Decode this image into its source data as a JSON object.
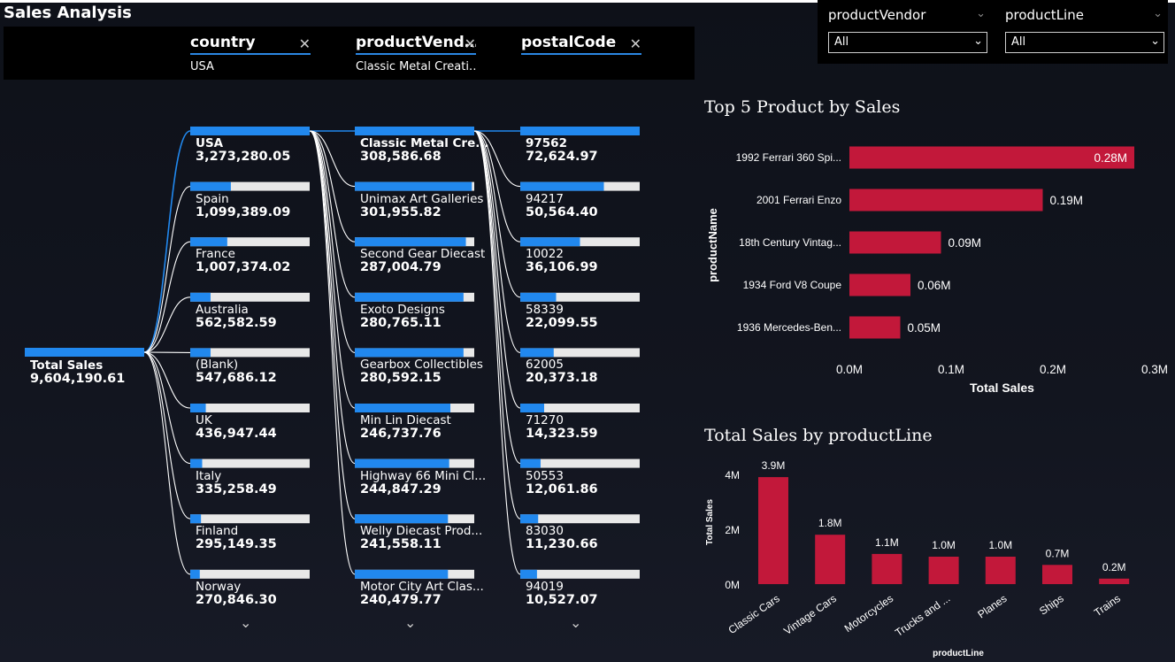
{
  "page_title": "Sales Analysis",
  "breadcrumbs": [
    {
      "level": "country",
      "value": "USA"
    },
    {
      "level": "productVend…",
      "value": "Classic Metal Creati…"
    },
    {
      "level": "postalCode",
      "value": ""
    }
  ],
  "slicers": [
    {
      "label": "productVendor",
      "value": "All"
    },
    {
      "label": "productLine",
      "value": "All"
    }
  ],
  "decomposition_tree": {
    "root": {
      "label": "Total Sales",
      "value": "9,604,190.61"
    },
    "levels": [
      {
        "nodes": [
          {
            "label": "USA",
            "value": "3,273,280.05",
            "share": 1.0
          },
          {
            "label": "Spain",
            "value": "1,099,389.09",
            "share": 0.34
          },
          {
            "label": "France",
            "value": "1,007,374.02",
            "share": 0.31
          },
          {
            "label": "Australia",
            "value": "562,582.59",
            "share": 0.17
          },
          {
            "label": "(Blank)",
            "value": "547,686.12",
            "share": 0.17
          },
          {
            "label": "UK",
            "value": "436,947.44",
            "share": 0.13
          },
          {
            "label": "Italy",
            "value": "335,258.49",
            "share": 0.1
          },
          {
            "label": "Finland",
            "value": "295,149.35",
            "share": 0.09
          },
          {
            "label": "Norway",
            "value": "270,846.30",
            "share": 0.08
          }
        ]
      },
      {
        "nodes": [
          {
            "label": "Classic Metal Cre...",
            "value": "308,586.68",
            "share": 1.0
          },
          {
            "label": "Unimax Art Galleries",
            "value": "301,955.82",
            "share": 0.98
          },
          {
            "label": "Second Gear Diecast",
            "value": "287,004.79",
            "share": 0.93
          },
          {
            "label": "Exoto Designs",
            "value": "280,765.11",
            "share": 0.91
          },
          {
            "label": "Gearbox Collectibles",
            "value": "280,592.15",
            "share": 0.91
          },
          {
            "label": "Min Lin Diecast",
            "value": "246,737.76",
            "share": 0.8
          },
          {
            "label": "Highway 66 Mini Cl...",
            "value": "244,847.29",
            "share": 0.79
          },
          {
            "label": "Welly Diecast Prod...",
            "value": "241,558.11",
            "share": 0.78
          },
          {
            "label": "Motor City Art Clas...",
            "value": "240,479.77",
            "share": 0.78
          }
        ]
      },
      {
        "nodes": [
          {
            "label": "97562",
            "value": "72,624.97",
            "share": 1.0
          },
          {
            "label": "94217",
            "value": "50,564.40",
            "share": 0.7
          },
          {
            "label": "10022",
            "value": "36,106.99",
            "share": 0.5
          },
          {
            "label": "58339",
            "value": "22,099.55",
            "share": 0.3
          },
          {
            "label": "62005",
            "value": "20,373.18",
            "share": 0.28
          },
          {
            "label": "71270",
            "value": "14,323.59",
            "share": 0.2
          },
          {
            "label": "50553",
            "value": "12,061.86",
            "share": 0.17
          },
          {
            "label": "83030",
            "value": "11,230.66",
            "share": 0.15
          },
          {
            "label": "94019",
            "value": "10,527.07",
            "share": 0.14
          }
        ]
      }
    ],
    "accent_color": "#2188ee",
    "track_color": "#e8e8e8"
  },
  "chart_data": [
    {
      "type": "bar",
      "orientation": "horizontal",
      "title": "Top 5 Product by Sales",
      "xlabel": "Total Sales",
      "ylabel": "productName",
      "categories": [
        "1992 Ferrari 360 Spi...",
        "2001 Ferrari Enzo",
        "18th Century Vintag...",
        "1934 Ford V8 Coupe",
        "1936 Mercedes-Ben..."
      ],
      "values": [
        0.28,
        0.19,
        0.09,
        0.06,
        0.05
      ],
      "data_labels": [
        "0.28M",
        "0.19M",
        "0.09M",
        "0.06M",
        "0.05M"
      ],
      "xlim": [
        0,
        0.3
      ],
      "ticks": [
        "0.0M",
        "0.1M",
        "0.2M",
        "0.3M"
      ],
      "color": "#c2183a"
    },
    {
      "type": "bar",
      "orientation": "vertical",
      "title": "Total Sales by productLine",
      "xlabel": "productLine",
      "ylabel": "Total Sales",
      "categories": [
        "Classic Cars",
        "Vintage Cars",
        "Motorcycles",
        "Trucks and ...",
        "Planes",
        "Ships",
        "Trains"
      ],
      "values": [
        3.9,
        1.8,
        1.1,
        1.0,
        1.0,
        0.7,
        0.2
      ],
      "data_labels": [
        "3.9M",
        "1.8M",
        "1.1M",
        "1.0M",
        "1.0M",
        "0.7M",
        "0.2M"
      ],
      "ylim": [
        0,
        4
      ],
      "ticks": [
        "0M",
        "2M",
        "4M"
      ],
      "color": "#c2183a"
    }
  ]
}
